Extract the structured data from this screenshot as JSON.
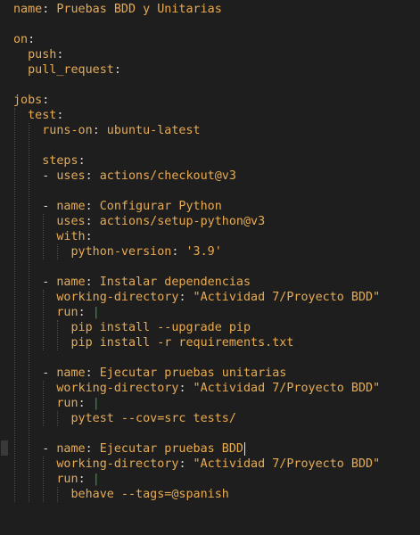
{
  "lines": [
    {
      "segments": [
        {
          "t": "name",
          "c": "key"
        },
        {
          "t": ":",
          "c": "punc"
        },
        {
          "t": " Pruebas BDD y Unitarias",
          "c": "str"
        }
      ]
    },
    {
      "segments": []
    },
    {
      "segments": [
        {
          "t": "on",
          "c": "key"
        },
        {
          "t": ":",
          "c": "punc"
        }
      ]
    },
    {
      "segments": [
        {
          "t": "  ",
          "c": "ind"
        },
        {
          "t": "push",
          "c": "key"
        },
        {
          "t": ":",
          "c": "punc"
        }
      ]
    },
    {
      "segments": [
        {
          "t": "  ",
          "c": "ind"
        },
        {
          "t": "pull_request",
          "c": "key"
        },
        {
          "t": ":",
          "c": "punc"
        }
      ]
    },
    {
      "segments": []
    },
    {
      "segments": [
        {
          "t": "jobs",
          "c": "key"
        },
        {
          "t": ":",
          "c": "punc"
        }
      ]
    },
    {
      "segments": [
        {
          "t": "  ",
          "c": "ind"
        },
        {
          "t": "test",
          "c": "key"
        },
        {
          "t": ":",
          "c": "punc"
        }
      ]
    },
    {
      "segments": [
        {
          "t": "    ",
          "c": "ind"
        },
        {
          "t": "runs-on",
          "c": "key"
        },
        {
          "t": ":",
          "c": "punc"
        },
        {
          "t": " ubuntu-latest",
          "c": "str"
        }
      ]
    },
    {
      "segments": []
    },
    {
      "segments": [
        {
          "t": "    ",
          "c": "ind"
        },
        {
          "t": "steps",
          "c": "key"
        },
        {
          "t": ":",
          "c": "punc"
        }
      ]
    },
    {
      "segments": [
        {
          "t": "    ",
          "c": "ind"
        },
        {
          "t": "- ",
          "c": "punc"
        },
        {
          "t": "uses",
          "c": "key"
        },
        {
          "t": ":",
          "c": "punc"
        },
        {
          "t": " actions/checkout@v3",
          "c": "str"
        }
      ]
    },
    {
      "segments": []
    },
    {
      "segments": [
        {
          "t": "    ",
          "c": "ind"
        },
        {
          "t": "- ",
          "c": "punc"
        },
        {
          "t": "name",
          "c": "key"
        },
        {
          "t": ":",
          "c": "punc"
        },
        {
          "t": " Configurar Python",
          "c": "str"
        }
      ]
    },
    {
      "segments": [
        {
          "t": "      ",
          "c": "ind"
        },
        {
          "t": "uses",
          "c": "key"
        },
        {
          "t": ":",
          "c": "punc"
        },
        {
          "t": " actions/setup-python@v3",
          "c": "str"
        }
      ]
    },
    {
      "segments": [
        {
          "t": "      ",
          "c": "ind"
        },
        {
          "t": "with",
          "c": "key"
        },
        {
          "t": ":",
          "c": "punc"
        }
      ]
    },
    {
      "segments": [
        {
          "t": "        ",
          "c": "ind"
        },
        {
          "t": "python-version",
          "c": "key"
        },
        {
          "t": ":",
          "c": "punc"
        },
        {
          "t": " '3.9'",
          "c": "str"
        }
      ]
    },
    {
      "segments": []
    },
    {
      "segments": [
        {
          "t": "    ",
          "c": "ind"
        },
        {
          "t": "- ",
          "c": "punc"
        },
        {
          "t": "name",
          "c": "key"
        },
        {
          "t": ":",
          "c": "punc"
        },
        {
          "t": " Instalar dependencias",
          "c": "str"
        }
      ]
    },
    {
      "segments": [
        {
          "t": "      ",
          "c": "ind"
        },
        {
          "t": "working-directory",
          "c": "key"
        },
        {
          "t": ":",
          "c": "punc"
        },
        {
          "t": " \"Actividad 7/Proyecto BDD\"",
          "c": "str"
        }
      ]
    },
    {
      "segments": [
        {
          "t": "      ",
          "c": "ind"
        },
        {
          "t": "run",
          "c": "key"
        },
        {
          "t": ":",
          "c": "punc"
        },
        {
          "t": " ",
          "c": "plain"
        },
        {
          "t": "|",
          "c": "pipe"
        }
      ]
    },
    {
      "segments": [
        {
          "t": "        ",
          "c": "ind"
        },
        {
          "t": "pip install --upgrade pip",
          "c": "str"
        }
      ]
    },
    {
      "segments": [
        {
          "t": "        ",
          "c": "ind"
        },
        {
          "t": "pip install -r requirements.txt",
          "c": "str"
        }
      ]
    },
    {
      "segments": []
    },
    {
      "segments": [
        {
          "t": "    ",
          "c": "ind"
        },
        {
          "t": "- ",
          "c": "punc"
        },
        {
          "t": "name",
          "c": "key"
        },
        {
          "t": ":",
          "c": "punc"
        },
        {
          "t": " Ejecutar pruebas unitarias",
          "c": "str"
        }
      ]
    },
    {
      "segments": [
        {
          "t": "      ",
          "c": "ind"
        },
        {
          "t": "working-directory",
          "c": "key"
        },
        {
          "t": ":",
          "c": "punc"
        },
        {
          "t": " \"Actividad 7/Proyecto BDD\"",
          "c": "str"
        }
      ]
    },
    {
      "segments": [
        {
          "t": "      ",
          "c": "ind"
        },
        {
          "t": "run",
          "c": "key"
        },
        {
          "t": ":",
          "c": "punc"
        },
        {
          "t": " ",
          "c": "plain"
        },
        {
          "t": "|",
          "c": "pipe"
        }
      ]
    },
    {
      "segments": [
        {
          "t": "        ",
          "c": "ind"
        },
        {
          "t": "pytest --cov=src tests/",
          "c": "str"
        }
      ]
    },
    {
      "segments": []
    },
    {
      "segments": [
        {
          "t": "    ",
          "c": "ind"
        },
        {
          "t": "- ",
          "c": "punc"
        },
        {
          "t": "name",
          "c": "key"
        },
        {
          "t": ":",
          "c": "punc"
        },
        {
          "t": " Ejecutar pruebas BDD",
          "c": "str"
        }
      ],
      "cursor": true
    },
    {
      "segments": [
        {
          "t": "      ",
          "c": "ind"
        },
        {
          "t": "working-directory",
          "c": "key"
        },
        {
          "t": ":",
          "c": "punc"
        },
        {
          "t": " \"Actividad 7/Proyecto BDD\"",
          "c": "str"
        }
      ]
    },
    {
      "segments": [
        {
          "t": "      ",
          "c": "ind"
        },
        {
          "t": "run",
          "c": "key"
        },
        {
          "t": ":",
          "c": "punc"
        },
        {
          "t": " ",
          "c": "plain"
        },
        {
          "t": "|",
          "c": "pipe"
        }
      ]
    },
    {
      "segments": [
        {
          "t": "        ",
          "c": "ind"
        },
        {
          "t": "behave --tags=@spanish",
          "c": "str"
        }
      ]
    }
  ],
  "colors": {
    "background": "#1e1e1e",
    "key": "#e8ab53",
    "string": "#e8ab53",
    "punctuation": "#d4d4d4",
    "pipe": "#3d9a3d",
    "indent_guide": "#4b4b4b"
  }
}
